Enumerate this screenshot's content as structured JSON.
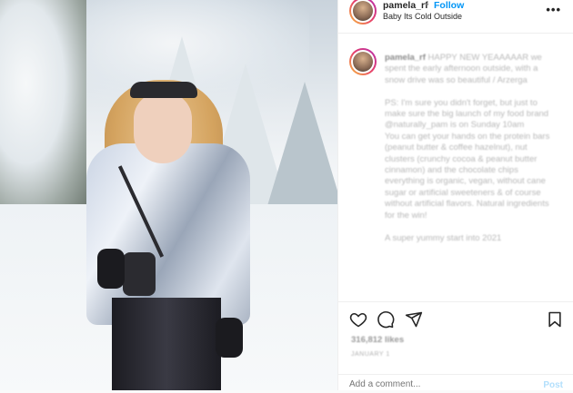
{
  "header": {
    "username": "pamela_rf",
    "separator": "•",
    "follow_label": "Follow",
    "location": "Baby Its Cold Outside",
    "more_label": "•••"
  },
  "caption": {
    "username": "pamela_rf",
    "text": "HAPPY NEW YEAAAAAR we spent the early afternoon outside, with a snow drive was so beautiful / Arzerga\n\nPS: I'm sure you didn't forget, but just to make sure the big launch of my food brand @naturally_pam is on Sunday 10am\nYou can get your hands on the protein bars (peanut butter & coffee hazelnut), nut clusters (crunchy cocoa & peanut butter cinnamon) and the chocolate chips\neverything is organic, vegan, without cane sugar or artificial sweeteners & of course without artificial flavors. Natural ingredients for the win!\n\nA super yummy start into 2021"
  },
  "actions": {
    "likes": "316,812 likes",
    "date": "JANUARY 1"
  },
  "comment": {
    "placeholder": "Add a comment...",
    "post_label": "Post"
  },
  "colors": {
    "accent": "#0095f6",
    "post_disabled": "#b2dffc"
  }
}
